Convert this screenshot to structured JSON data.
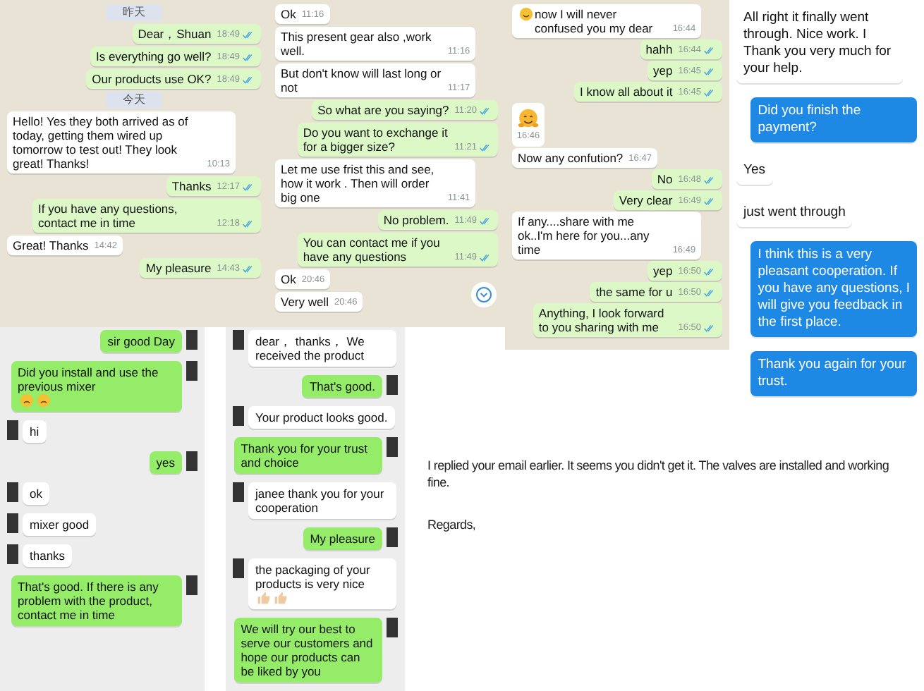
{
  "panels": [
    {
      "kind": "whatsapp",
      "items": [
        {
          "kind": "date",
          "text": "昨天"
        },
        {
          "kind": "msg",
          "outgoing": true,
          "text": "Dear，Shuan",
          "time": "18:49",
          "read": true
        },
        {
          "kind": "msg",
          "outgoing": true,
          "text": "Is everything go well?",
          "time": "18:49",
          "read": true
        },
        {
          "kind": "msg",
          "outgoing": true,
          "text": "Our products use OK?",
          "time": "18:49",
          "read": true
        },
        {
          "kind": "date",
          "text": "今天"
        },
        {
          "kind": "msg",
          "outgoing": false,
          "text": "Hello! Yes they both arrived as of today, getting them wired up tomorrow to test out! They look great! Thanks!",
          "time": "10:13"
        },
        {
          "kind": "msg",
          "outgoing": true,
          "text": "Thanks",
          "time": "12:17",
          "read": true
        },
        {
          "kind": "msg",
          "outgoing": true,
          "text": "If you have any questions, contact me in time",
          "time": "12:18",
          "read": true
        },
        {
          "kind": "msg",
          "outgoing": false,
          "text": "Great! Thanks",
          "time": "14:42"
        },
        {
          "kind": "msg",
          "outgoing": true,
          "text": "My pleasure",
          "time": "14:43",
          "read": true
        }
      ]
    },
    {
      "kind": "whatsapp",
      "scroll_button": true,
      "items": [
        {
          "kind": "msg",
          "outgoing": false,
          "text": "Ok",
          "time": "11:16"
        },
        {
          "kind": "msg",
          "outgoing": false,
          "text": "This present gear also ,work well.",
          "time": "11:16"
        },
        {
          "kind": "msg",
          "outgoing": false,
          "text": "But don't know will last long or not",
          "time": "11:17"
        },
        {
          "kind": "msg",
          "outgoing": true,
          "text": "So what are you saying?",
          "time": "11:20",
          "read": true
        },
        {
          "kind": "msg",
          "outgoing": true,
          "text": "Do you want to exchange it for a bigger size?",
          "time": "11:21",
          "read": true
        },
        {
          "kind": "msg",
          "outgoing": false,
          "text": "Let me use frist this and see, how it work . Then will order big one",
          "time": "11:41"
        },
        {
          "kind": "msg",
          "outgoing": true,
          "text": "No problem.",
          "time": "11:49",
          "read": true
        },
        {
          "kind": "msg",
          "outgoing": true,
          "text": "You can contact me if you have any questions",
          "time": "11:49",
          "read": true
        },
        {
          "kind": "msg",
          "outgoing": false,
          "text": "Ok",
          "time": "20:46"
        },
        {
          "kind": "msg",
          "outgoing": false,
          "text": "Very well",
          "time": "20:46"
        }
      ]
    },
    {
      "kind": "whatsapp",
      "items": [
        {
          "kind": "msg",
          "outgoing": false,
          "text": "now I will never confused you my dear",
          "time": "16:44",
          "emojis_before": [
            {
              "kind": "smiley"
            }
          ]
        },
        {
          "kind": "msg",
          "outgoing": true,
          "text": "hahh",
          "time": "16:44",
          "read": true
        },
        {
          "kind": "msg",
          "outgoing": true,
          "text": "yep",
          "time": "16:45",
          "read": true
        },
        {
          "kind": "msg",
          "outgoing": true,
          "text": "I know all about it",
          "time": "16:45",
          "read": true
        },
        {
          "kind": "sticker",
          "outgoing": false,
          "time": "16:46"
        },
        {
          "kind": "msg",
          "outgoing": false,
          "text": "Now any confution?",
          "time": "16:47"
        },
        {
          "kind": "msg",
          "outgoing": true,
          "text": "No",
          "time": "16:48",
          "read": true
        },
        {
          "kind": "msg",
          "outgoing": true,
          "text": "Very clear",
          "time": "16:49",
          "read": true
        },
        {
          "kind": "msg",
          "outgoing": false,
          "text": "If any....share with me ok..I'm here for you...any time",
          "time": "16:49"
        },
        {
          "kind": "msg",
          "outgoing": true,
          "text": "yep",
          "time": "16:50",
          "read": true
        },
        {
          "kind": "msg",
          "outgoing": true,
          "text": "the same for u",
          "time": "16:50",
          "read": true
        },
        {
          "kind": "msg",
          "outgoing": true,
          "text": "Anything, I look forward to you sharing with me",
          "time": "16:50",
          "read": true
        }
      ]
    },
    {
      "kind": "blue",
      "items": [
        {
          "kind": "msg",
          "outgoing": false,
          "text": "All right it finally went through. Nice work.  I Thank you very much for your help."
        },
        {
          "kind": "msg",
          "outgoing": true,
          "text": "Did you finish the payment?"
        },
        {
          "kind": "msg",
          "outgoing": false,
          "text": "Yes"
        },
        {
          "kind": "msg",
          "outgoing": false,
          "text": "just went through"
        },
        {
          "kind": "msg",
          "outgoing": true,
          "text": "I think this is a very pleasant cooperation. If you have any questions, I will give you feedback in the first place."
        },
        {
          "kind": "msg",
          "outgoing": true,
          "text": "Thank you again for your trust."
        }
      ]
    },
    {
      "kind": "wechat",
      "items": [
        {
          "kind": "msg",
          "outgoing": true,
          "text": "sir good Day"
        },
        {
          "kind": "msg",
          "outgoing": true,
          "text": "Did you install and use the previous mixer",
          "emojis_after": [
            {
              "kind": "smiley"
            },
            {
              "kind": "smiley"
            }
          ]
        },
        {
          "kind": "msg",
          "outgoing": false,
          "text": "hi"
        },
        {
          "kind": "msg",
          "outgoing": true,
          "text": "yes"
        },
        {
          "kind": "msg",
          "outgoing": false,
          "text": "ok"
        },
        {
          "kind": "msg",
          "outgoing": false,
          "text": "mixer good"
        },
        {
          "kind": "msg",
          "outgoing": false,
          "text": "thanks"
        },
        {
          "kind": "msg",
          "outgoing": true,
          "text": "That's good. If there is any problem with the product, contact me in time"
        }
      ]
    },
    {
      "kind": "wechat",
      "items": [
        {
          "kind": "msg",
          "outgoing": false,
          "text": "dear， thanks，  We received the product"
        },
        {
          "kind": "msg",
          "outgoing": true,
          "text": "That's good."
        },
        {
          "kind": "msg",
          "outgoing": false,
          "text": "Your product looks good."
        },
        {
          "kind": "msg",
          "outgoing": true,
          "text": "Thank you for your trust and choice"
        },
        {
          "kind": "msg",
          "outgoing": false,
          "text": "janee  thank you for your cooperation"
        },
        {
          "kind": "msg",
          "outgoing": true,
          "text": "My pleasure"
        },
        {
          "kind": "msg",
          "outgoing": false,
          "text": "the packaging of your products is very nice",
          "emojis_after": [
            {
              "kind": "thumbs-up"
            },
            {
              "kind": "thumbs-up"
            }
          ]
        },
        {
          "kind": "msg",
          "outgoing": true,
          "text": "We will try our best to serve our customers and hope our products can be liked by you"
        }
      ]
    },
    {
      "kind": "email",
      "items": [
        {
          "text": "I replied your email earlier. It seems you didn't get it. The valves are installed and working fine."
        },
        {
          "text": "Regards,"
        }
      ]
    }
  ]
}
